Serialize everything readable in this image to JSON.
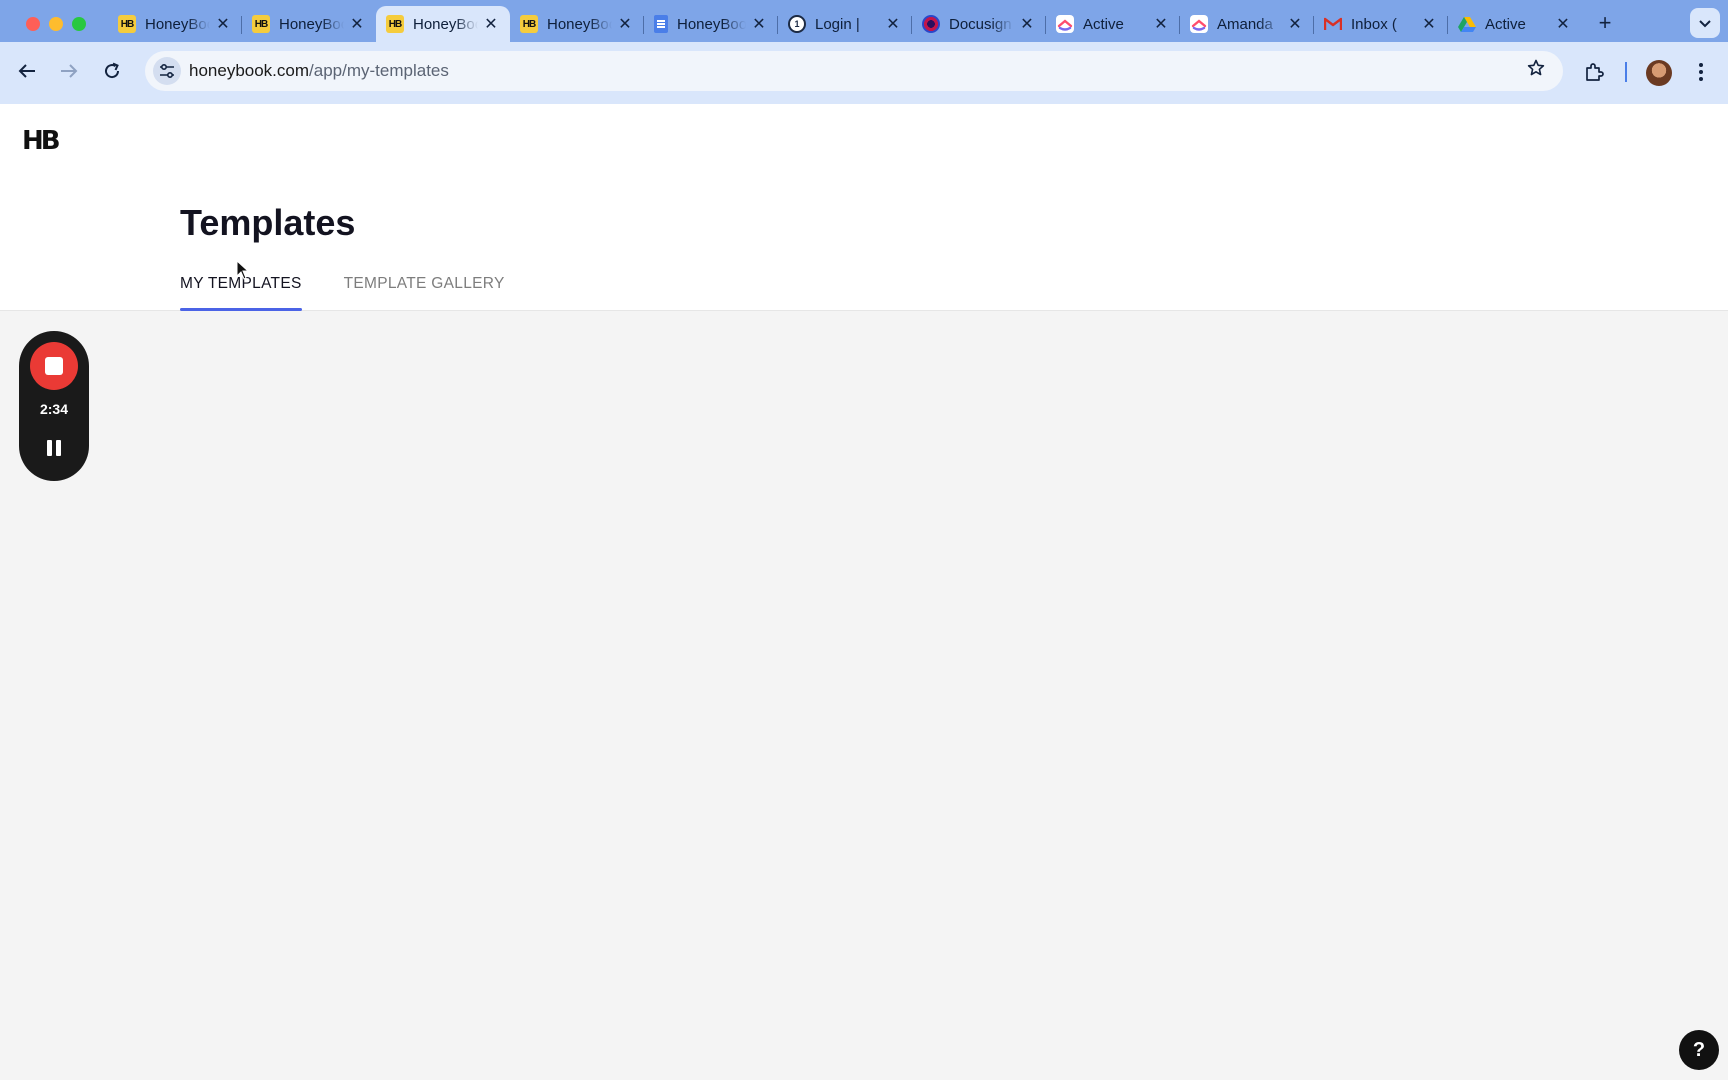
{
  "browser": {
    "tabs": [
      {
        "title": "HoneyBook",
        "favicon": "honeybook-favicon"
      },
      {
        "title": "HoneyBook",
        "favicon": "honeybook-favicon"
      },
      {
        "title": "HoneyBook",
        "favicon": "honeybook-favicon",
        "active": true
      },
      {
        "title": "HoneyBook",
        "favicon": "honeybook-favicon"
      },
      {
        "title": "HoneyBook",
        "favicon": "google-docs-favicon"
      },
      {
        "title": "Login |",
        "favicon": "onepassword-favicon"
      },
      {
        "title": "Docusign",
        "favicon": "docusign-favicon"
      },
      {
        "title": "Active",
        "favicon": "clickup-favicon"
      },
      {
        "title": "Amanda",
        "favicon": "clickup-favicon"
      },
      {
        "title": "Inbox (",
        "favicon": "gmail-favicon"
      },
      {
        "title": "Active",
        "favicon": "google-drive-favicon"
      }
    ],
    "close_glyph": "✕",
    "new_tab_glyph": "+",
    "url_host": "honeybook.com",
    "url_path": "/app/my-templates"
  },
  "app": {
    "logo_text": "HB",
    "page_title": "Templates",
    "tabs": [
      {
        "label": "MY TEMPLATES",
        "active": true
      },
      {
        "label": "TEMPLATE GALLERY",
        "active": false
      }
    ]
  },
  "recorder": {
    "elapsed": "2:34"
  },
  "help": {
    "label": "?"
  },
  "colors": {
    "browser_frame": "#7ea5e8",
    "tab_accent": "#4b63e6",
    "record_red": "#ea3a35"
  }
}
